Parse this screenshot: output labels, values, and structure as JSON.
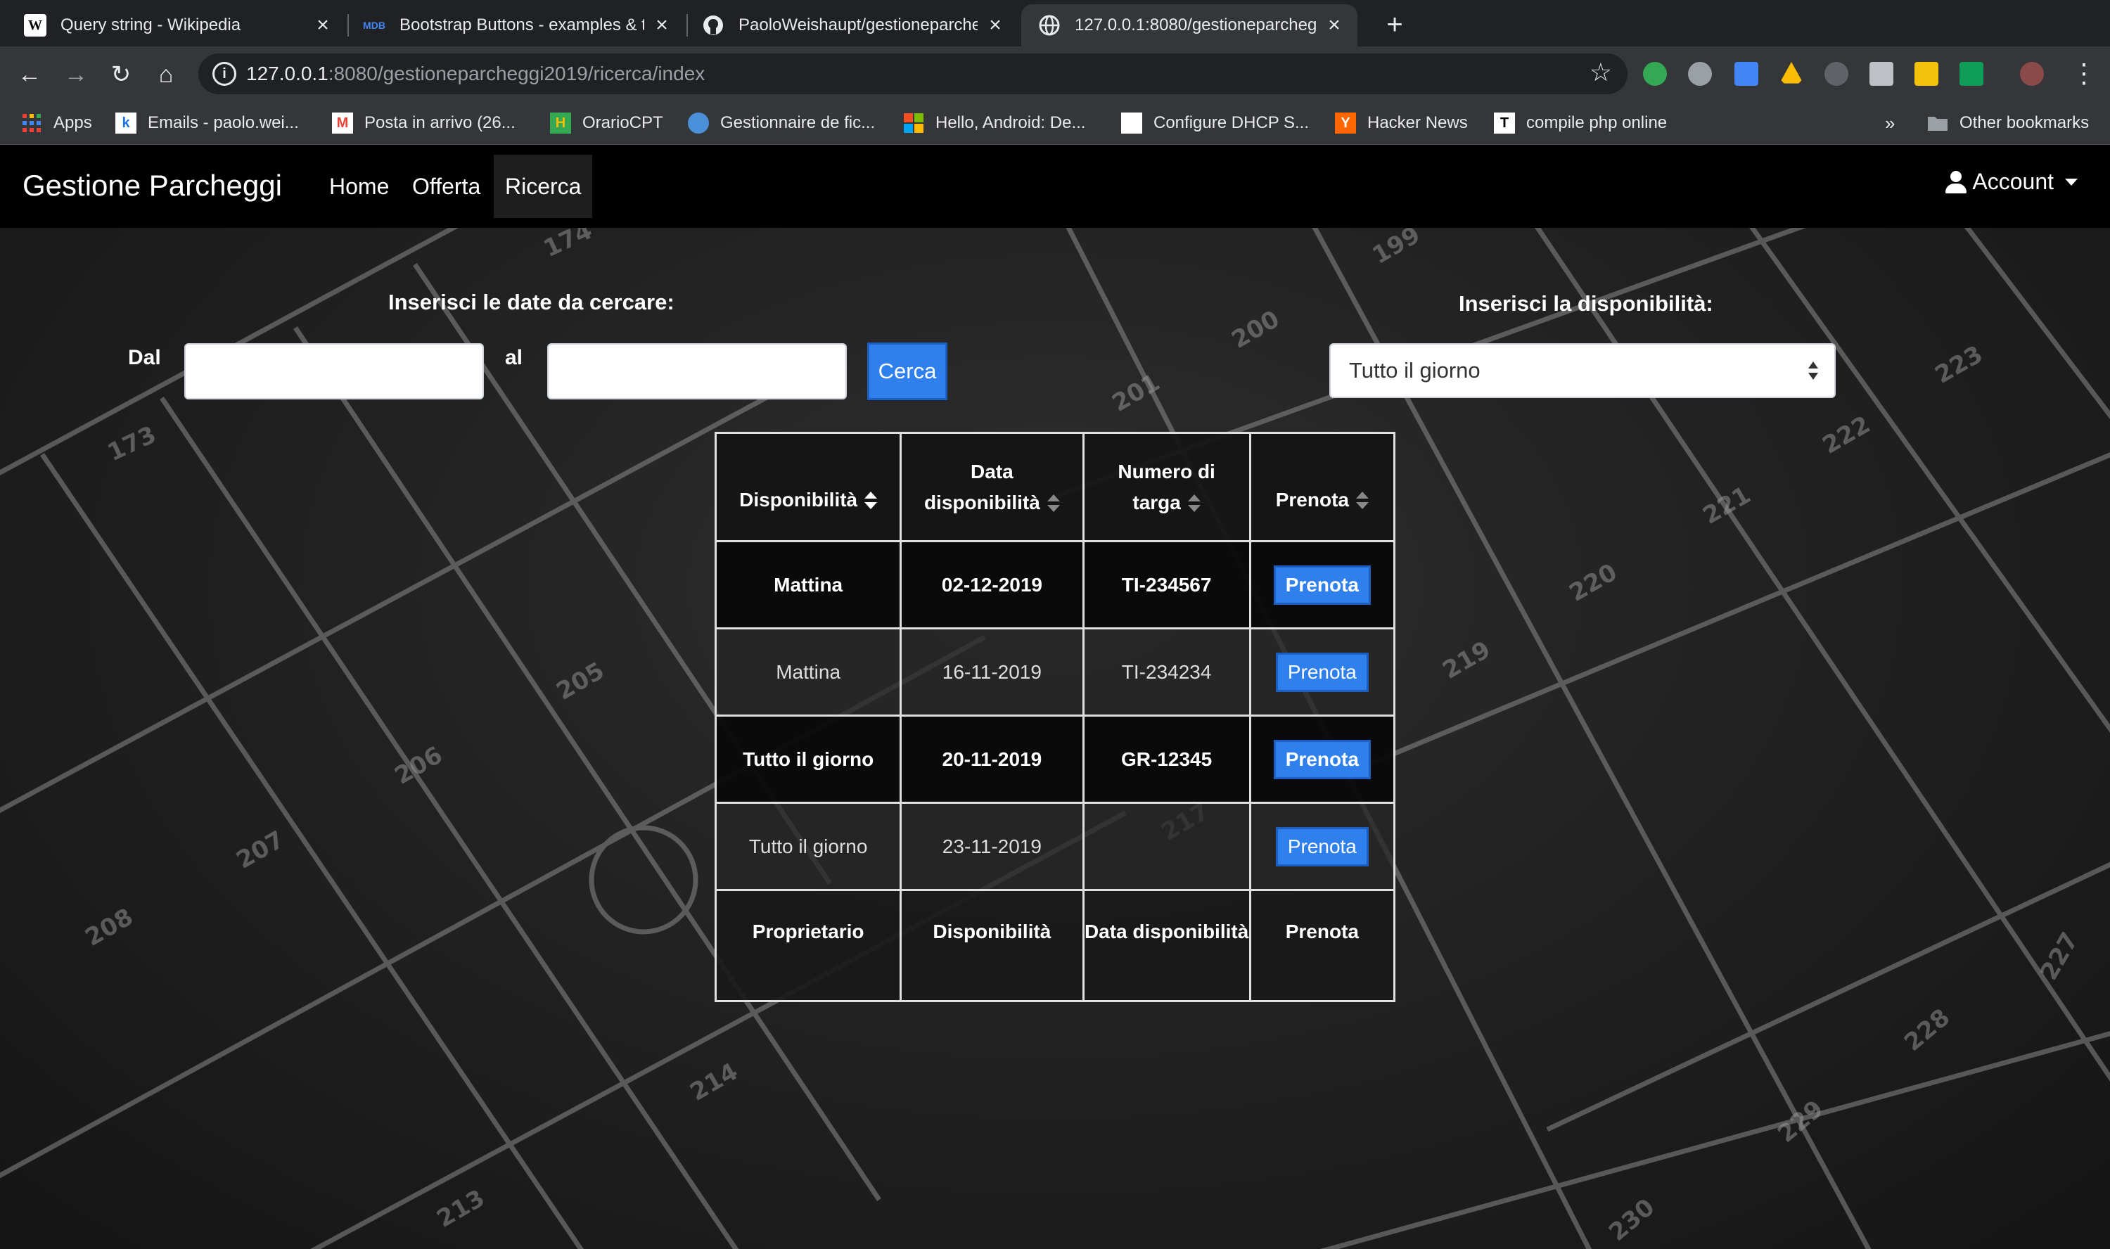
{
  "browser": {
    "tabs": [
      {
        "title": "Query string - Wikipedia",
        "favicon": "W"
      },
      {
        "title": "Bootstrap Buttons - examples & t",
        "favicon": "MDB"
      },
      {
        "title": "PaoloWeishaupt/gestioneparcheg",
        "favicon": "github-icon"
      },
      {
        "title": "127.0.0.1:8080/gestioneparcheg",
        "favicon": "globe-icon"
      }
    ],
    "url_host": "127.0.0.1",
    "url_rest": ":8080/gestioneparcheggi2019/ricerca/index",
    "bookmarks": [
      {
        "label": "Apps",
        "icon": "apps-grid-icon"
      },
      {
        "label": "Emails - paolo.wei...",
        "icon": "k"
      },
      {
        "label": "Posta in arrivo (26...",
        "icon": "M"
      },
      {
        "label": "OrarioCPT",
        "icon": "H"
      },
      {
        "label": "Gestionnaire de fic...",
        "icon": "globe-icon"
      },
      {
        "label": "Hello, Android: De...",
        "icon": "windows-icon"
      },
      {
        "label": "Configure DHCP S...",
        "icon": "page-icon"
      },
      {
        "label": "Hacker News",
        "icon": "Y"
      },
      {
        "label": "compile php online",
        "icon": "T"
      }
    ],
    "overflow_label": "»",
    "other_bookmarks": "Other bookmarks"
  },
  "navbar": {
    "brand": "Gestione Parcheggi",
    "links": [
      "Home",
      "Offerta",
      "Ricerca"
    ],
    "account": "Account"
  },
  "search": {
    "dates_heading": "Inserisci le date da cercare:",
    "from_label": "Dal",
    "to_label": "al",
    "from_value": "",
    "to_value": "",
    "button": "Cerca",
    "availability_heading": "Inserisci la disponibilità:",
    "availability_selected": "Tutto il giorno"
  },
  "table": {
    "headers": [
      "Disponibilità",
      "Data disponibilità",
      "Numero di targa",
      "Prenota"
    ],
    "rows": [
      {
        "disponibilita": "Mattina",
        "data": "02-12-2019",
        "targa": "TI-234567",
        "action": "Prenota"
      },
      {
        "disponibilita": "Mattina",
        "data": "16-11-2019",
        "targa": "TI-234234",
        "action": "Prenota"
      },
      {
        "disponibilita": "Tutto il giorno",
        "data": "20-11-2019",
        "targa": "GR-12345",
        "action": "Prenota"
      },
      {
        "disponibilita": "Tutto il giorno",
        "data": "23-11-2019",
        "targa": "",
        "action": "Prenota"
      }
    ],
    "footer": [
      "Proprietario",
      "Disponibilità",
      "Data disponibilità",
      "Prenota"
    ]
  },
  "colors": {
    "accent": "#2f80ed",
    "navbar": "#000000",
    "chrome_dark": "#202124",
    "chrome": "#35363a"
  }
}
